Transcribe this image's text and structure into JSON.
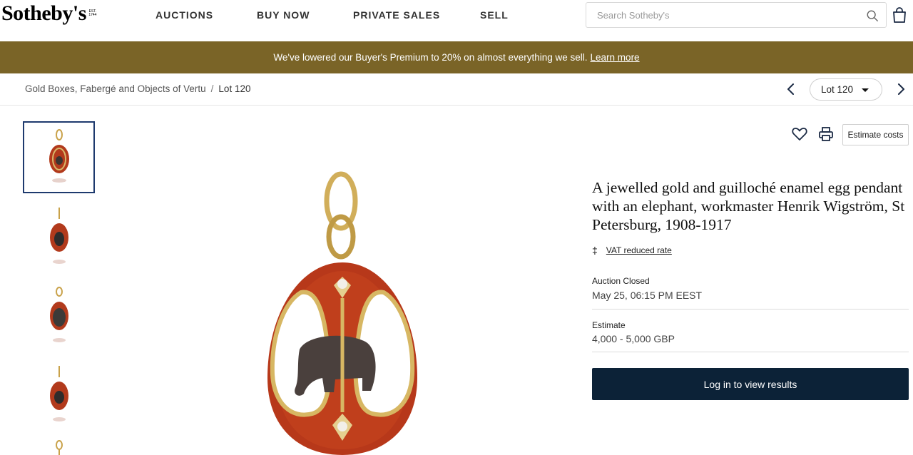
{
  "logo": {
    "name": "Sotheby's",
    "est_mark": "EST. 1744"
  },
  "nav": {
    "items": [
      "AUCTIONS",
      "BUY NOW",
      "PRIVATE SALES",
      "SELL"
    ]
  },
  "search": {
    "placeholder": "Search Sotheby's",
    "icon": "search-icon"
  },
  "cart": {
    "icon": "bag-icon"
  },
  "banner": {
    "message": "We've lowered our Buyer's Premium to 20% on almost everything we sell.",
    "link_label": "Learn more",
    "background_color": "#7a6427"
  },
  "breadcrumb": {
    "parent": "Gold Boxes, Fabergé and Objects of Vertu",
    "separator": "/",
    "current": "Lot 120"
  },
  "lot_nav": {
    "selected_lot": "Lot 120",
    "prev_icon": "chevron-left-icon",
    "next_icon": "chevron-right-icon"
  },
  "gallery": {
    "thumbnail_count": 5,
    "active_index": 0
  },
  "actions": {
    "favorite_icon": "heart-icon",
    "print_icon": "print-icon",
    "estimate_costs_label": "Estimate costs"
  },
  "lot": {
    "title": "A jewelled gold and guilloché enamel egg pendant with an elephant, workmaster Henrik Wigström, St Petersburg, 1908-1917",
    "vat_symbol": "‡",
    "vat_label": "VAT reduced rate",
    "status_label": "Auction Closed",
    "closed_at": "May 25, 06:15 PM EEST",
    "estimate_label": "Estimate",
    "estimate_value": "4,000 - 5,000 GBP"
  },
  "login_button": {
    "label": "Log in to view results",
    "color": "#0c2237"
  }
}
